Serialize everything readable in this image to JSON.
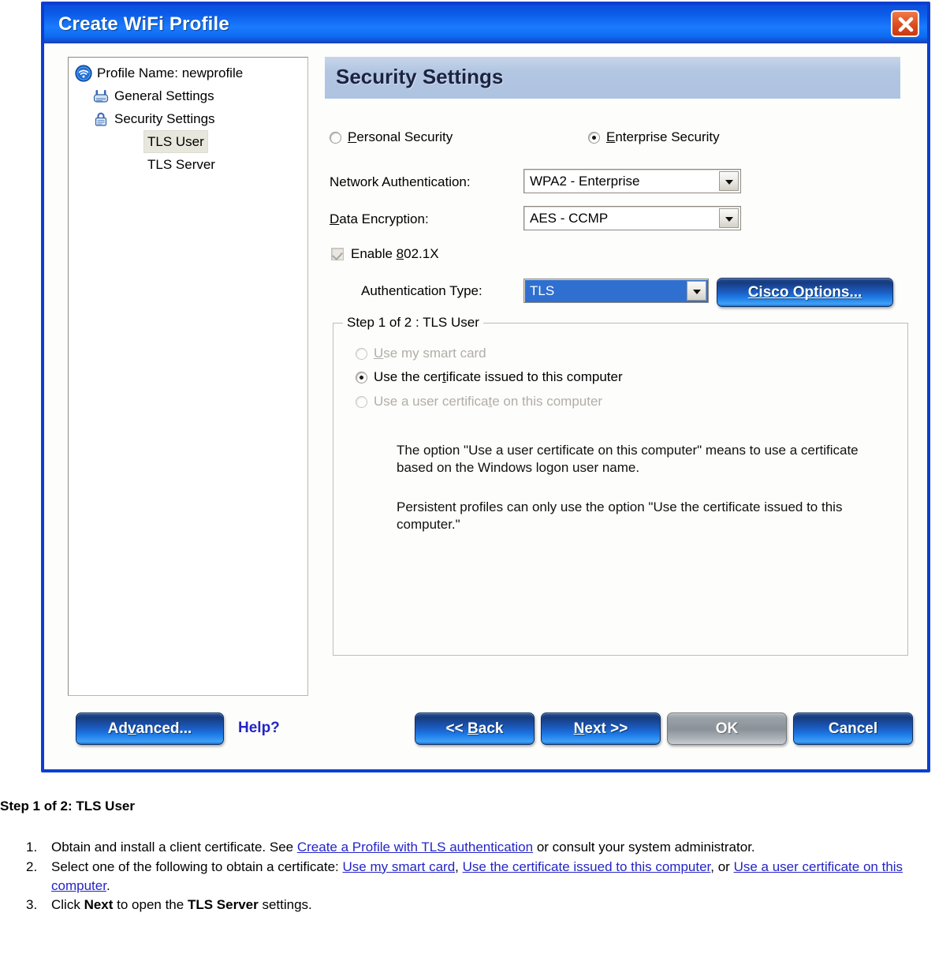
{
  "window": {
    "title": "Create WiFi Profile",
    "close_icon": "close-icon"
  },
  "tree": {
    "items": [
      {
        "label": "Profile Name: newprofile",
        "icon": "wifi-icon",
        "selected": false,
        "indent": 0
      },
      {
        "label": "General Settings",
        "icon": "access-point-icon",
        "selected": false,
        "indent": 1
      },
      {
        "label": "Security Settings",
        "icon": "lock-icon",
        "selected": false,
        "indent": 1
      },
      {
        "label": "TLS User",
        "icon": "none",
        "selected": true,
        "indent": 2
      },
      {
        "label": "TLS Server",
        "icon": "none",
        "selected": false,
        "indent": 2
      }
    ]
  },
  "panel": {
    "header": "Security Settings",
    "security_mode": {
      "personal_label": "Personal Security",
      "enterprise_label": "Enterprise Security",
      "selected": "Enterprise Security"
    },
    "fields": {
      "network_auth_label": "Network Authentication:",
      "network_auth_value": "WPA2 - Enterprise",
      "data_encryption_label": "Data Encryption:",
      "data_encryption_value": "AES - CCMP",
      "enable_8021x_label": "Enable 802.1X",
      "enable_8021x_checked": true,
      "auth_type_label": "Authentication Type:",
      "auth_type_value": "TLS",
      "cisco_options_label": "Cisco Options..."
    },
    "group": {
      "legend": "Step 1 of 2 : TLS User",
      "options": [
        {
          "label": "Use my smart card",
          "selected": false,
          "enabled": false
        },
        {
          "label": "Use the certificate issued to this computer",
          "selected": true,
          "enabled": true
        },
        {
          "label": "Use a user certificate on this computer",
          "selected": false,
          "enabled": false
        }
      ],
      "note_1": "The option \"Use a user certificate on this computer\" means to use a certificate based on the Windows logon user name.",
      "note_2": "Persistent profiles can only use the option \"Use the certificate issued to this computer.\""
    }
  },
  "footer": {
    "advanced_label": "Advanced...",
    "help_label": "Help?",
    "back_label": "<< Back",
    "next_label": "Next >>",
    "ok_label": "OK",
    "cancel_label": "Cancel",
    "ok_enabled": false
  },
  "doc": {
    "heading": "Step 1 of 2: TLS User",
    "steps": [
      {
        "num": "1.",
        "parts": [
          {
            "t": "Obtain and install a client certificate. See ",
            "k": "text"
          },
          {
            "t": "Create a Profile with TLS authentication",
            "k": "link"
          },
          {
            "t": " or consult your system administrator.",
            "k": "text"
          }
        ]
      },
      {
        "num": "2.",
        "parts": [
          {
            "t": "Select one of the following to obtain a certificate: ",
            "k": "text"
          },
          {
            "t": "Use my smart card",
            "k": "link"
          },
          {
            "t": ", ",
            "k": "text"
          },
          {
            "t": "Use the certificate issued to this computer",
            "k": "link"
          },
          {
            "t": ", or ",
            "k": "text"
          },
          {
            "t": "Use a user certificate on this computer",
            "k": "link"
          },
          {
            "t": ".",
            "k": "text"
          }
        ]
      },
      {
        "num": "3.",
        "parts": [
          {
            "t": "Click ",
            "k": "text"
          },
          {
            "t": "Next",
            "k": "bold"
          },
          {
            "t": " to open the ",
            "k": "text"
          },
          {
            "t": "TLS Server",
            "k": "bold"
          },
          {
            "t": " settings.",
            "k": "text"
          }
        ]
      }
    ]
  },
  "colors": {
    "title_blue": "#0a5ae8",
    "dialog_border": "#0b3fd0",
    "header_band": "#b2c6e2",
    "link": "#2424c8",
    "combo_selected": "#2f6fd0"
  }
}
